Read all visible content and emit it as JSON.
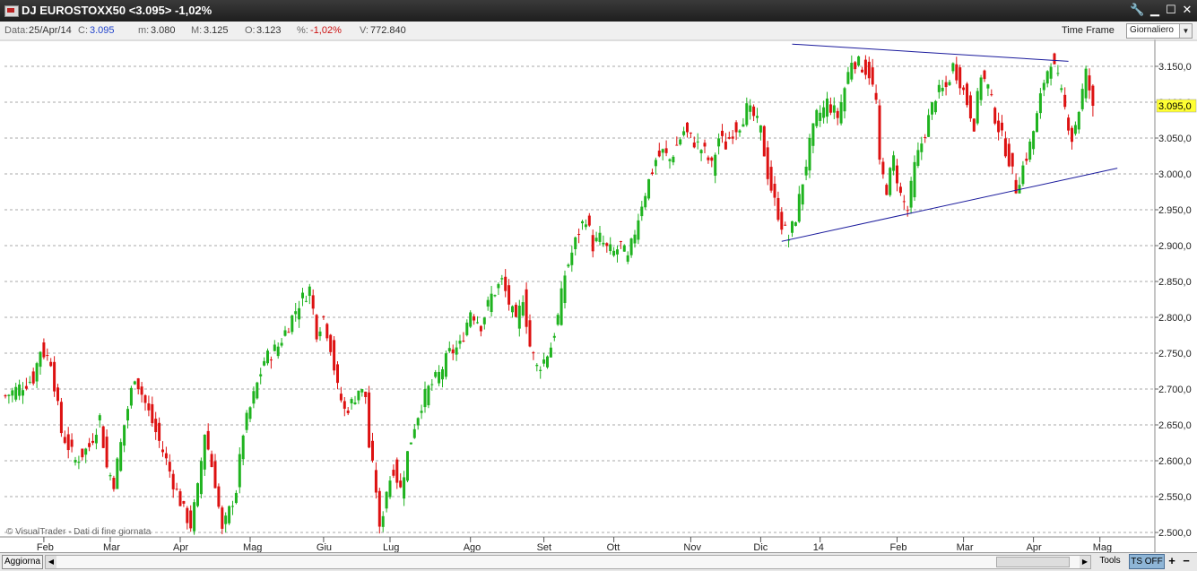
{
  "window": {
    "title": "DJ EUROSTOXX50 <3.095> -1,02%",
    "tools_icon": "wrench-icon",
    "minimize_icon": "minimize-icon",
    "maximize_icon": "maximize-icon",
    "close_icon": "close-icon"
  },
  "info": {
    "data_label": "Data:",
    "data_value": "25/Apr/14",
    "c_label": "C:",
    "c_value": "3.095",
    "m_label": "m:",
    "m_value": "3.080",
    "M_label": "M:",
    "M_value": "3.125",
    "o_label": "O:",
    "o_value": "3.123",
    "pct_label": "%:",
    "pct_value": "-1,02%",
    "v_label": "V:",
    "v_value": "772.840",
    "timeframe_label": "Time Frame",
    "timeframe_value": "Giornaliero"
  },
  "footer": {
    "aggiorna": "Aggiorna",
    "tools": "Tools",
    "ts": "TS OFF",
    "plus": "+",
    "minus": "−"
  },
  "colors": {
    "up": "#1fb31f",
    "down": "#dd1111",
    "trendline": "#1a1a9c",
    "grid": "#aaaaaa",
    "price_tag": "#ffff33"
  },
  "chart_data": {
    "type": "candlestick",
    "watermark": "© VisualTrader - Dati di fine giornata",
    "last_price_label": "3.095,0",
    "ylim": [
      2475,
      3190
    ],
    "yticks": [
      2500,
      2550,
      2600,
      2650,
      2700,
      2750,
      2800,
      2850,
      2900,
      2950,
      3000,
      3050,
      3100,
      3150
    ],
    "ytick_labels": [
      "2.500,0",
      "2.550,0",
      "2.600,0",
      "2.650,0",
      "2.700,0",
      "2.750,0",
      "2.800,0",
      "2.850,0",
      "2.900,0",
      "2.950,0",
      "3.000,0",
      "3.050,0",
      "3.100,0",
      "3.150,0"
    ],
    "months": [
      {
        "label": "Feb",
        "start": 11
      },
      {
        "label": "Mar",
        "start": 30
      },
      {
        "label": "Apr",
        "start": 50
      },
      {
        "label": "Mag",
        "start": 70
      },
      {
        "label": "Giu",
        "start": 91
      },
      {
        "label": "Lug",
        "start": 110
      },
      {
        "label": "Ago",
        "start": 133
      },
      {
        "label": "Set",
        "start": 154
      },
      {
        "label": "Ott",
        "start": 174
      },
      {
        "label": "Nov",
        "start": 196
      },
      {
        "label": "Dic",
        "start": 216
      },
      {
        "label": "14",
        "start": 233
      },
      {
        "label": "Feb",
        "start": 255
      },
      {
        "label": "Mar",
        "start": 274
      },
      {
        "label": "Apr",
        "start": 294
      },
      {
        "label": "Mag",
        "start": 313
      }
    ],
    "n_bars": 312,
    "anchors": [
      [
        0,
        2690
      ],
      [
        8,
        2715
      ],
      [
        10,
        2755
      ],
      [
        13,
        2740
      ],
      [
        16,
        2640
      ],
      [
        20,
        2600
      ],
      [
        24,
        2620
      ],
      [
        27,
        2660
      ],
      [
        29,
        2590
      ],
      [
        31,
        2570
      ],
      [
        34,
        2650
      ],
      [
        37,
        2720
      ],
      [
        40,
        2680
      ],
      [
        43,
        2640
      ],
      [
        46,
        2600
      ],
      [
        48,
        2570
      ],
      [
        51,
        2530
      ],
      [
        53,
        2510
      ],
      [
        55,
        2560
      ],
      [
        57,
        2640
      ],
      [
        60,
        2570
      ],
      [
        62,
        2500
      ],
      [
        64,
        2530
      ],
      [
        66,
        2560
      ],
      [
        68,
        2640
      ],
      [
        71,
        2690
      ],
      [
        74,
        2740
      ],
      [
        78,
        2760
      ],
      [
        81,
        2790
      ],
      [
        84,
        2820
      ],
      [
        87,
        2840
      ],
      [
        89,
        2780
      ],
      [
        91,
        2800
      ],
      [
        93,
        2760
      ],
      [
        95,
        2700
      ],
      [
        97,
        2670
      ],
      [
        99,
        2680
      ],
      [
        101,
        2700
      ],
      [
        103,
        2690
      ],
      [
        104,
        2620
      ],
      [
        106,
        2560
      ],
      [
        107,
        2500
      ],
      [
        109,
        2560
      ],
      [
        111,
        2590
      ],
      [
        113,
        2560
      ],
      [
        115,
        2610
      ],
      [
        117,
        2650
      ],
      [
        119,
        2680
      ],
      [
        121,
        2700
      ],
      [
        124,
        2720
      ],
      [
        127,
        2750
      ],
      [
        130,
        2760
      ],
      [
        133,
        2810
      ],
      [
        136,
        2790
      ],
      [
        139,
        2830
      ],
      [
        142,
        2850
      ],
      [
        144,
        2820
      ],
      [
        146,
        2790
      ],
      [
        148,
        2830
      ],
      [
        150,
        2760
      ],
      [
        152,
        2730
      ],
      [
        154,
        2740
      ],
      [
        156,
        2760
      ],
      [
        158,
        2800
      ],
      [
        160,
        2860
      ],
      [
        162,
        2890
      ],
      [
        164,
        2920
      ],
      [
        166,
        2940
      ],
      [
        168,
        2900
      ],
      [
        170,
        2910
      ],
      [
        172,
        2895
      ],
      [
        174,
        2890
      ],
      [
        176,
        2900
      ],
      [
        178,
        2880
      ],
      [
        180,
        2920
      ],
      [
        182,
        2960
      ],
      [
        184,
        2990
      ],
      [
        186,
        3020
      ],
      [
        188,
        3030
      ],
      [
        190,
        3020
      ],
      [
        192,
        3040
      ],
      [
        194,
        3060
      ],
      [
        196,
        3050
      ],
      [
        198,
        3040
      ],
      [
        200,
        3030
      ],
      [
        202,
        3010
      ],
      [
        204,
        3050
      ],
      [
        206,
        3040
      ],
      [
        208,
        3060
      ],
      [
        210,
        3070
      ],
      [
        212,
        3090
      ],
      [
        214,
        3080
      ],
      [
        216,
        3060
      ],
      [
        218,
        3000
      ],
      [
        220,
        2960
      ],
      [
        222,
        2930
      ],
      [
        224,
        2910
      ],
      [
        226,
        2940
      ],
      [
        228,
        2990
      ],
      [
        230,
        3040
      ],
      [
        232,
        3080
      ],
      [
        234,
        3090
      ],
      [
        235,
        3100
      ],
      [
        238,
        3080
      ],
      [
        240,
        3120
      ],
      [
        242,
        3160
      ],
      [
        245,
        3150
      ],
      [
        247,
        3140
      ],
      [
        249,
        3100
      ],
      [
        250,
        3010
      ],
      [
        252,
        2980
      ],
      [
        254,
        3020
      ],
      [
        256,
        2970
      ],
      [
        258,
        2950
      ],
      [
        260,
        3010
      ],
      [
        263,
        3060
      ],
      [
        266,
        3110
      ],
      [
        269,
        3120
      ],
      [
        271,
        3150
      ],
      [
        273,
        3130
      ],
      [
        275,
        3100
      ],
      [
        277,
        3070
      ],
      [
        279,
        3140
      ],
      [
        281,
        3120
      ],
      [
        283,
        3080
      ],
      [
        285,
        3050
      ],
      [
        287,
        3020
      ],
      [
        289,
        2980
      ],
      [
        291,
        3010
      ],
      [
        293,
        3040
      ],
      [
        295,
        3080
      ],
      [
        297,
        3130
      ],
      [
        299,
        3160
      ],
      [
        301,
        3130
      ],
      [
        303,
        3090
      ],
      [
        305,
        3050
      ],
      [
        307,
        3090
      ],
      [
        309,
        3140
      ],
      [
        311,
        3095
      ]
    ],
    "trendlines": [
      {
        "x1": 225,
        "y1": 3181,
        "x2": 304,
        "y2": 3157
      },
      {
        "x1": 222,
        "y1": 2906,
        "x2": 318,
        "y2": 3008
      }
    ]
  }
}
